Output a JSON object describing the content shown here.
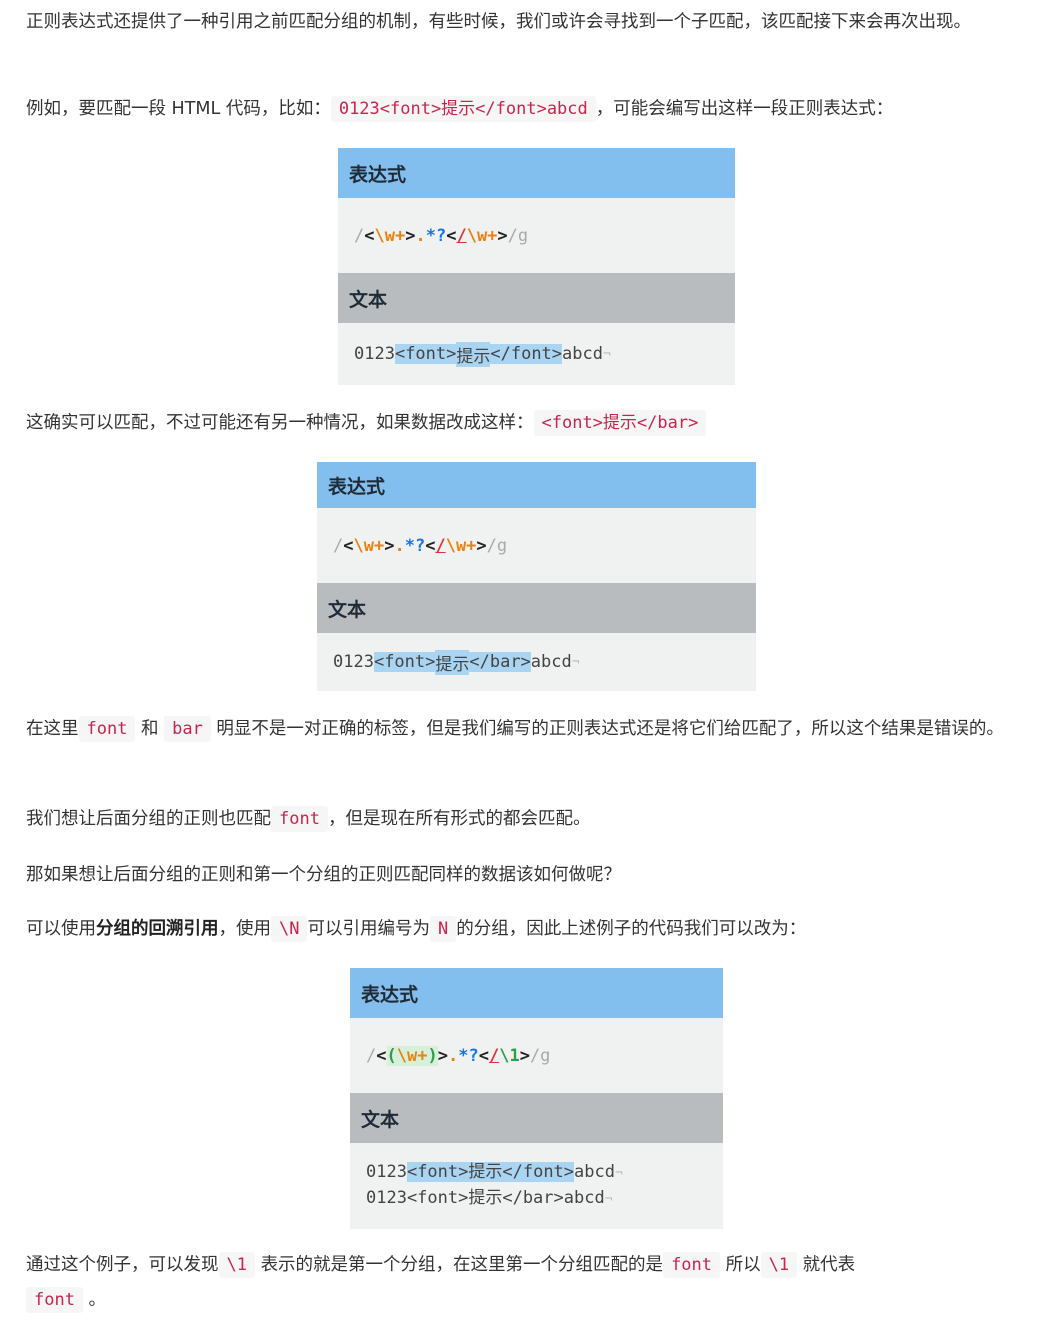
{
  "p1": "正则表达式还提供了一种引用之前匹配分组的机制，有些时候，我们或许会寻找到一个子匹配，该匹配接下来会再次出现。",
  "p2": {
    "before": "例如，要匹配一段 HTML 代码，比如：",
    "code": "0123<font>提示</font>abcd",
    "after": "，可能会编写出这样一段正则表达式："
  },
  "fig_labels": {
    "expression": "表达式",
    "text": "文本"
  },
  "fig1": {
    "expr": [
      "/",
      "<",
      "\\w+",
      ">",
      ".",
      "*?",
      "<",
      "/",
      "\\w+",
      ">",
      "/g"
    ],
    "text": {
      "pre": "0123",
      "m1": "<font>",
      "mid": "提示",
      "m2": "</font>",
      "post": "abcd",
      "pilcrow": "¬"
    }
  },
  "p3": {
    "before": "这确实可以匹配，不过可能还有另一种情况，如果数据改成这样：",
    "code": "<font>提示</bar>"
  },
  "fig2": {
    "expr": [
      "/",
      "<",
      "\\w+",
      ">",
      ".",
      "*?",
      "<",
      "/",
      "\\w+",
      ">",
      "/g"
    ],
    "text": {
      "pre": "0123",
      "m1": "<font>",
      "mid": "提示",
      "m2": "</bar>",
      "post": "abcd",
      "pilcrow": "¬"
    }
  },
  "p4": {
    "t1": "在这里",
    "c1": "font",
    "t2": "和",
    "c2": "bar",
    "t3": "明显不是一对正确的标签，但是我们编写的正则表达式还是将它们给匹配了，所以这个结果是错误的。"
  },
  "p5": {
    "t1": "我们想让后面分组的正则也匹配",
    "c1": "font",
    "t2": "，但是现在所有形式的都会匹配。"
  },
  "p6": "那如果想让后面分组的正则和第一个分组的正则匹配同样的数据该如何做呢？",
  "p7": {
    "t1": "可以使用",
    "strong": "分组的回溯引用",
    "t2": "，使用",
    "c1": "\\N",
    "t3": "可以引用编号为",
    "c2": "N",
    "t4": "的分组，因此上述例子的代码我们可以改为："
  },
  "fig3": {
    "expr": [
      "/",
      "<",
      "(",
      "\\w+",
      ")",
      ">",
      ".",
      "*?",
      "<",
      "/",
      "\\1",
      ">",
      "/g"
    ],
    "text1": {
      "pre": "0123",
      "m1": "<font>",
      "mid": "提示",
      "m2": "</font>",
      "post": "abcd",
      "pilcrow": "¬"
    },
    "text2": {
      "line": "0123<font>提示</bar>abcd",
      "pilcrow": "¬"
    }
  },
  "p8": {
    "t1": "通过这个例子，可以发现",
    "c1": "\\1",
    "t2": "表示的就是第一个分组，在这里第一个分组匹配的是",
    "c2": "font",
    "t3": "所以",
    "c3": "\\1",
    "t4": "就代表",
    "c4": "font",
    "t5": "。"
  }
}
